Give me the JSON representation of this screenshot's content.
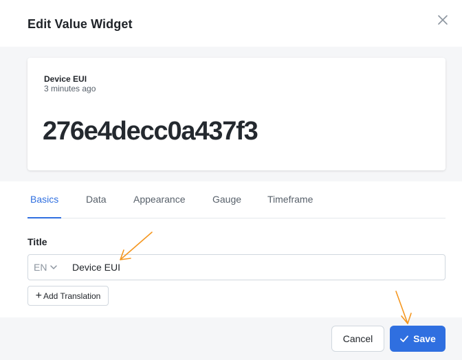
{
  "dialog": {
    "title": "Edit Value Widget",
    "close_icon": "close-icon"
  },
  "preview": {
    "label": "Device EUI",
    "time": "3 minutes ago",
    "value": "276e4decc0a437f3"
  },
  "tabs": [
    {
      "label": "Basics",
      "active": true
    },
    {
      "label": "Data",
      "active": false
    },
    {
      "label": "Appearance",
      "active": false
    },
    {
      "label": "Gauge",
      "active": false
    },
    {
      "label": "Timeframe",
      "active": false
    }
  ],
  "form": {
    "title_label": "Title",
    "lang": "EN",
    "title_value": "Device EUI",
    "add_translation": "Add Translation"
  },
  "footer": {
    "cancel": "Cancel",
    "save": "Save"
  },
  "colors": {
    "accent": "#2f6fe0",
    "annotation_arrow": "#f5961e"
  }
}
